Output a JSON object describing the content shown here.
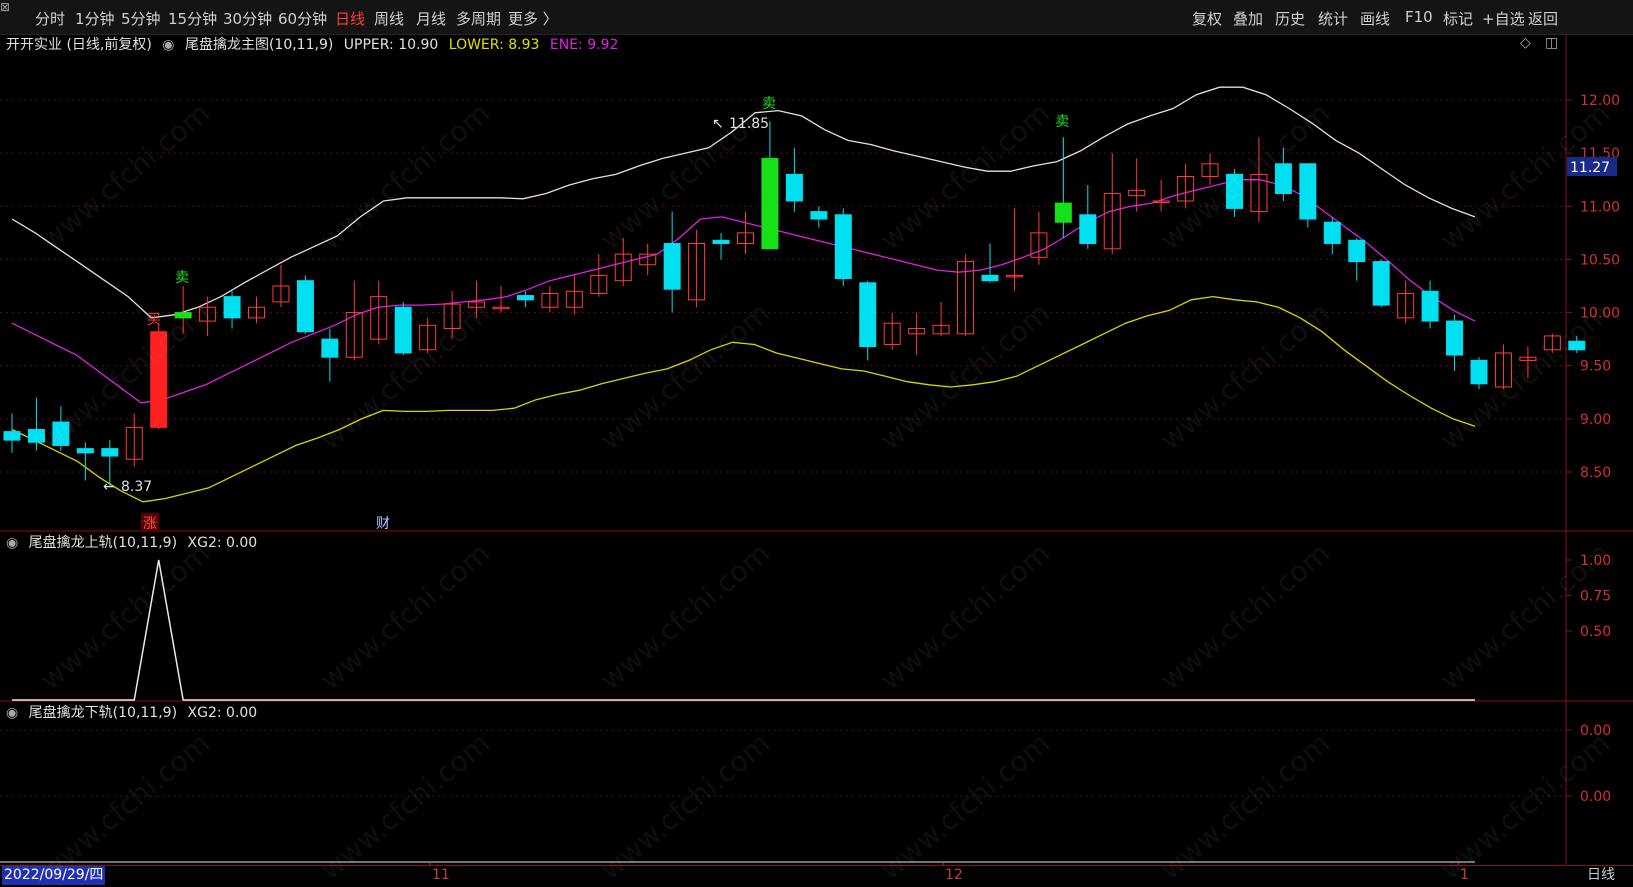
{
  "toolbar": {
    "periods": [
      "分时",
      "1分钟",
      "5分钟",
      "15分钟",
      "30分钟",
      "60分钟",
      "日线",
      "周线",
      "月线",
      "多周期",
      "更多 〉"
    ],
    "active_period": "日线",
    "actions": [
      "复权",
      "叠加",
      "历史",
      "统计",
      "画线",
      "F10",
      "标记",
      "+自选",
      "返回"
    ]
  },
  "main_panel": {
    "stock_label": "开开实业 (日线,前复权)",
    "indicator": "尾盘擒龙主图(10,11,9)",
    "upper_label": "UPPER: 10.90",
    "lower_label": "LOWER: 8.93",
    "ene_label": "ENE: 9.92",
    "colors": {
      "upper": "#e0e0e0",
      "lower": "#d6d600",
      "ene": "#e020e0",
      "up": "#ff3b3b",
      "down": "#00e0f0"
    },
    "price_axis": [
      "12.00",
      "11.50",
      "11.00",
      "10.50",
      "10.00",
      "9.50",
      "9.00",
      "8.50"
    ],
    "current_price": "11.27",
    "high_label": "11.85",
    "low_label": "8.37",
    "sell_mark": "卖",
    "buy_mark": "买",
    "event_rise": "涨",
    "event_fin": "财"
  },
  "sub1": {
    "title": "尾盘擒龙上轨(10,11,9)",
    "value": "XG2: 0.00",
    "axis": [
      "1.00",
      "0.75",
      "0.50"
    ]
  },
  "sub2": {
    "title": "尾盘擒龙下轨(10,11,9)",
    "value": "XG2: 0.00",
    "axis": [
      "0.00",
      "0.00"
    ]
  },
  "bottom": {
    "date": "2022/09/29/四",
    "month_11": "11",
    "month_12": "12",
    "month_1": "1",
    "period_label": "日线"
  },
  "watermark": "www.cfchi.com",
  "candles": [
    [
      8.88,
      8.8,
      9.05,
      8.68
    ],
    [
      8.9,
      8.78,
      9.2,
      8.7
    ],
    [
      8.97,
      8.75,
      9.12,
      8.7
    ],
    [
      8.72,
      8.68,
      8.78,
      8.42
    ],
    [
      8.72,
      8.65,
      8.8,
      8.37
    ],
    [
      8.62,
      8.92,
      9.05,
      8.55
    ],
    [
      8.92,
      9.82,
      9.9,
      8.9
    ],
    [
      9.95,
      10.0,
      10.25,
      9.8
    ],
    [
      9.92,
      10.05,
      10.15,
      9.78
    ],
    [
      10.15,
      9.95,
      10.2,
      9.85
    ],
    [
      9.95,
      10.05,
      10.15,
      9.9
    ],
    [
      10.1,
      10.25,
      10.45,
      10.05
    ],
    [
      10.3,
      9.82,
      10.35,
      9.8
    ],
    [
      9.75,
      9.58,
      9.85,
      9.35
    ],
    [
      9.58,
      10.0,
      10.3,
      9.55
    ],
    [
      9.75,
      10.15,
      10.3,
      9.7
    ],
    [
      10.05,
      9.62,
      10.1,
      9.6
    ],
    [
      9.65,
      9.88,
      9.95,
      9.62
    ],
    [
      9.85,
      10.08,
      10.2,
      9.75
    ],
    [
      10.05,
      10.1,
      10.3,
      9.95
    ],
    [
      10.05,
      10.05,
      10.25,
      10.0
    ],
    [
      10.16,
      10.12,
      10.2,
      10.05
    ],
    [
      10.05,
      10.18,
      10.25,
      10.0
    ],
    [
      10.05,
      10.2,
      10.35,
      9.98
    ],
    [
      10.18,
      10.35,
      10.55,
      10.15
    ],
    [
      10.3,
      10.55,
      10.7,
      10.25
    ],
    [
      10.45,
      10.55,
      10.65,
      10.35
    ],
    [
      10.65,
      10.22,
      10.95,
      10.0
    ],
    [
      10.12,
      10.65,
      10.78,
      10.05
    ],
    [
      10.68,
      10.65,
      10.75,
      10.5
    ],
    [
      10.65,
      10.75,
      10.95,
      10.55
    ],
    [
      11.45,
      10.6,
      11.8,
      10.6
    ],
    [
      11.3,
      11.05,
      11.55,
      10.95
    ],
    [
      10.95,
      10.88,
      11.0,
      10.8
    ],
    [
      10.92,
      10.32,
      10.98,
      10.25
    ],
    [
      10.28,
      9.68,
      10.3,
      9.55
    ],
    [
      9.7,
      9.9,
      10.0,
      9.65
    ],
    [
      9.8,
      9.85,
      10.0,
      9.6
    ],
    [
      9.8,
      9.88,
      10.1,
      9.78
    ],
    [
      9.8,
      10.48,
      10.55,
      9.78
    ],
    [
      10.35,
      10.3,
      10.65,
      10.28
    ],
    [
      10.35,
      10.35,
      10.98,
      10.2
    ],
    [
      10.52,
      10.75,
      10.95,
      10.45
    ],
    [
      11.03,
      10.85,
      11.65,
      10.7
    ],
    [
      10.92,
      10.65,
      11.2,
      10.6
    ],
    [
      10.6,
      11.12,
      11.5,
      10.55
    ],
    [
      11.1,
      11.15,
      11.45,
      10.95
    ],
    [
      11.05,
      11.05,
      11.25,
      10.95
    ],
    [
      11.05,
      11.28,
      11.4,
      10.98
    ],
    [
      11.28,
      11.4,
      11.5,
      11.2
    ],
    [
      11.3,
      10.98,
      11.35,
      10.9
    ],
    [
      10.95,
      11.3,
      11.65,
      10.85
    ],
    [
      11.4,
      11.12,
      11.55,
      11.05
    ],
    [
      11.4,
      10.88,
      11.4,
      10.8
    ],
    [
      10.85,
      10.65,
      10.9,
      10.55
    ],
    [
      10.68,
      10.48,
      10.7,
      10.3
    ],
    [
      10.48,
      10.07,
      10.5,
      10.05
    ],
    [
      9.95,
      10.18,
      10.3,
      9.9
    ],
    [
      10.2,
      9.92,
      10.3,
      9.85
    ],
    [
      9.92,
      9.6,
      9.98,
      9.45
    ],
    [
      9.55,
      9.33,
      9.58,
      9.28
    ],
    [
      9.3,
      9.62,
      9.7,
      9.28
    ],
    [
      9.55,
      9.58,
      9.68,
      9.38
    ],
    [
      9.65,
      9.78,
      9.8,
      9.62
    ],
    [
      9.73,
      9.65,
      9.78,
      9.62
    ]
  ],
  "upper_line": [
    10.88,
    10.75,
    10.6,
    10.45,
    10.3,
    10.15,
    9.95,
    9.98,
    10.05,
    10.15,
    10.28,
    10.4,
    10.52,
    10.62,
    10.72,
    10.9,
    11.05,
    11.08,
    11.08,
    11.08,
    11.08,
    11.08,
    11.07,
    11.12,
    11.2,
    11.26,
    11.3,
    11.38,
    11.45,
    11.5,
    11.55,
    11.7,
    11.88,
    11.9,
    11.85,
    11.72,
    11.62,
    11.58,
    11.52,
    11.47,
    11.42,
    11.37,
    11.33,
    11.33,
    11.38,
    11.42,
    11.52,
    11.65,
    11.77,
    11.85,
    11.92,
    12.05,
    12.12,
    12.12,
    12.05,
    11.92,
    11.78,
    11.62,
    11.5,
    11.35,
    11.2,
    11.08,
    10.98,
    10.9
  ],
  "ene_line": [
    9.9,
    9.8,
    9.7,
    9.6,
    9.45,
    9.3,
    9.15,
    9.18,
    9.25,
    9.32,
    9.42,
    9.52,
    9.62,
    9.72,
    9.8,
    9.88,
    9.98,
    10.05,
    10.07,
    10.07,
    10.08,
    10.1,
    10.12,
    10.15,
    10.22,
    10.3,
    10.35,
    10.4,
    10.45,
    10.5,
    10.55,
    10.7,
    10.88,
    10.9,
    10.85,
    10.8,
    10.75,
    10.7,
    10.65,
    10.6,
    10.55,
    10.5,
    10.45,
    10.4,
    10.38,
    10.4,
    10.45,
    10.52,
    10.6,
    10.72,
    10.85,
    10.95,
    11.0,
    11.03,
    11.1,
    11.15,
    11.2,
    11.25,
    11.25,
    11.2,
    11.1,
    10.95,
    10.8,
    10.65,
    10.48,
    10.3,
    10.15,
    10.02,
    9.92
  ],
  "lower_line": [
    8.9,
    8.8,
    8.7,
    8.6,
    8.45,
    8.32,
    8.22,
    8.25,
    8.3,
    8.35,
    8.45,
    8.55,
    8.65,
    8.75,
    8.82,
    8.9,
    9.0,
    9.08,
    9.07,
    9.07,
    9.08,
    9.08,
    9.08,
    9.1,
    9.18,
    9.23,
    9.27,
    9.33,
    9.38,
    9.43,
    9.47,
    9.55,
    9.65,
    9.72,
    9.7,
    9.62,
    9.57,
    9.52,
    9.47,
    9.45,
    9.4,
    9.35,
    9.32,
    9.3,
    9.32,
    9.35,
    9.4,
    9.5,
    9.6,
    9.7,
    9.8,
    9.9,
    9.97,
    10.02,
    10.12,
    10.15,
    10.12,
    10.1,
    10.05,
    9.95,
    9.82,
    9.65,
    9.5,
    9.35,
    9.22,
    9.1,
    9.0,
    8.93
  ]
}
